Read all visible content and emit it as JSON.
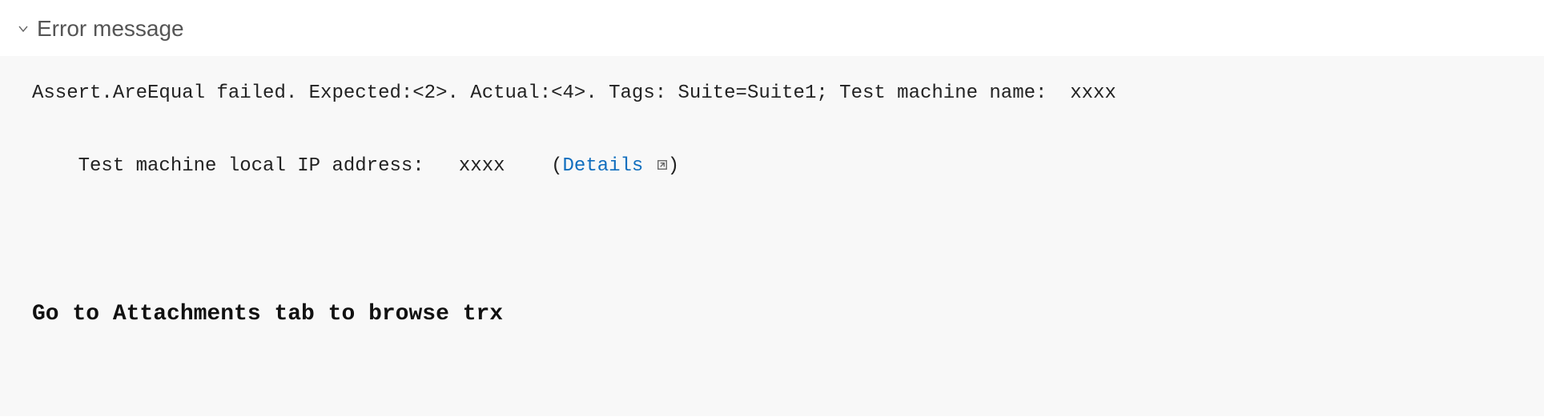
{
  "header": {
    "title": "Error message"
  },
  "error": {
    "line1": "Assert.AreEqual failed. Expected:<2>. Actual:<4>. Tags: Suite=Suite1; Test machine name:  xxxx",
    "line2_prefix": "Test machine local IP address:   xxxx    (",
    "details_label": "Details",
    "line2_suffix": ")"
  },
  "note": "Go to Attachments tab to browse trx",
  "colors": {
    "link": "#106ebe",
    "body_bg": "#f8f8f8"
  }
}
